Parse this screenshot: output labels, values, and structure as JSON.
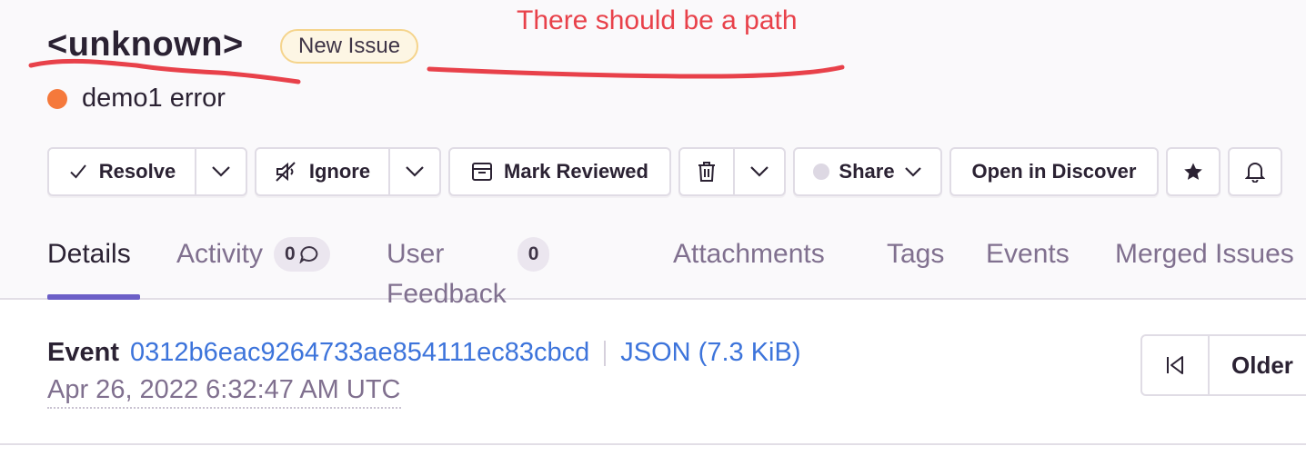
{
  "issue": {
    "title": "<unknown>",
    "badge": "New Issue",
    "subtitle": "demo1 error",
    "level_color": "#f5793b"
  },
  "annotation": {
    "text": "There should be a path",
    "color": "#e8414a"
  },
  "actions": {
    "resolve_label": "Resolve",
    "ignore_label": "Ignore",
    "mark_reviewed_label": "Mark Reviewed",
    "share_label": "Share",
    "open_discover_label": "Open in Discover",
    "icons": [
      "checkmark-icon",
      "chevron-down-icon",
      "mute-icon",
      "inbox-icon",
      "trash-icon",
      "status-dot-icon",
      "star-icon",
      "bell-icon"
    ]
  },
  "tabs": [
    {
      "label": "Details",
      "active": true
    },
    {
      "label": "Activity",
      "count": "0"
    },
    {
      "label": "User Feedback",
      "count": "0"
    },
    {
      "label": "Attachments"
    },
    {
      "label": "Tags"
    },
    {
      "label": "Events"
    },
    {
      "label": "Merged Issues"
    }
  ],
  "event": {
    "label": "Event",
    "id": "0312b6eac9264733ae854111ec83cbcd",
    "json_link": "JSON (7.3 KiB)",
    "date": "Apr 26, 2022 6:32:47 AM UTC"
  },
  "pager": {
    "older_label": "Older"
  },
  "colors": {
    "accent": "#6c5fc7",
    "link": "#3d74db",
    "muted": "#80708f"
  }
}
